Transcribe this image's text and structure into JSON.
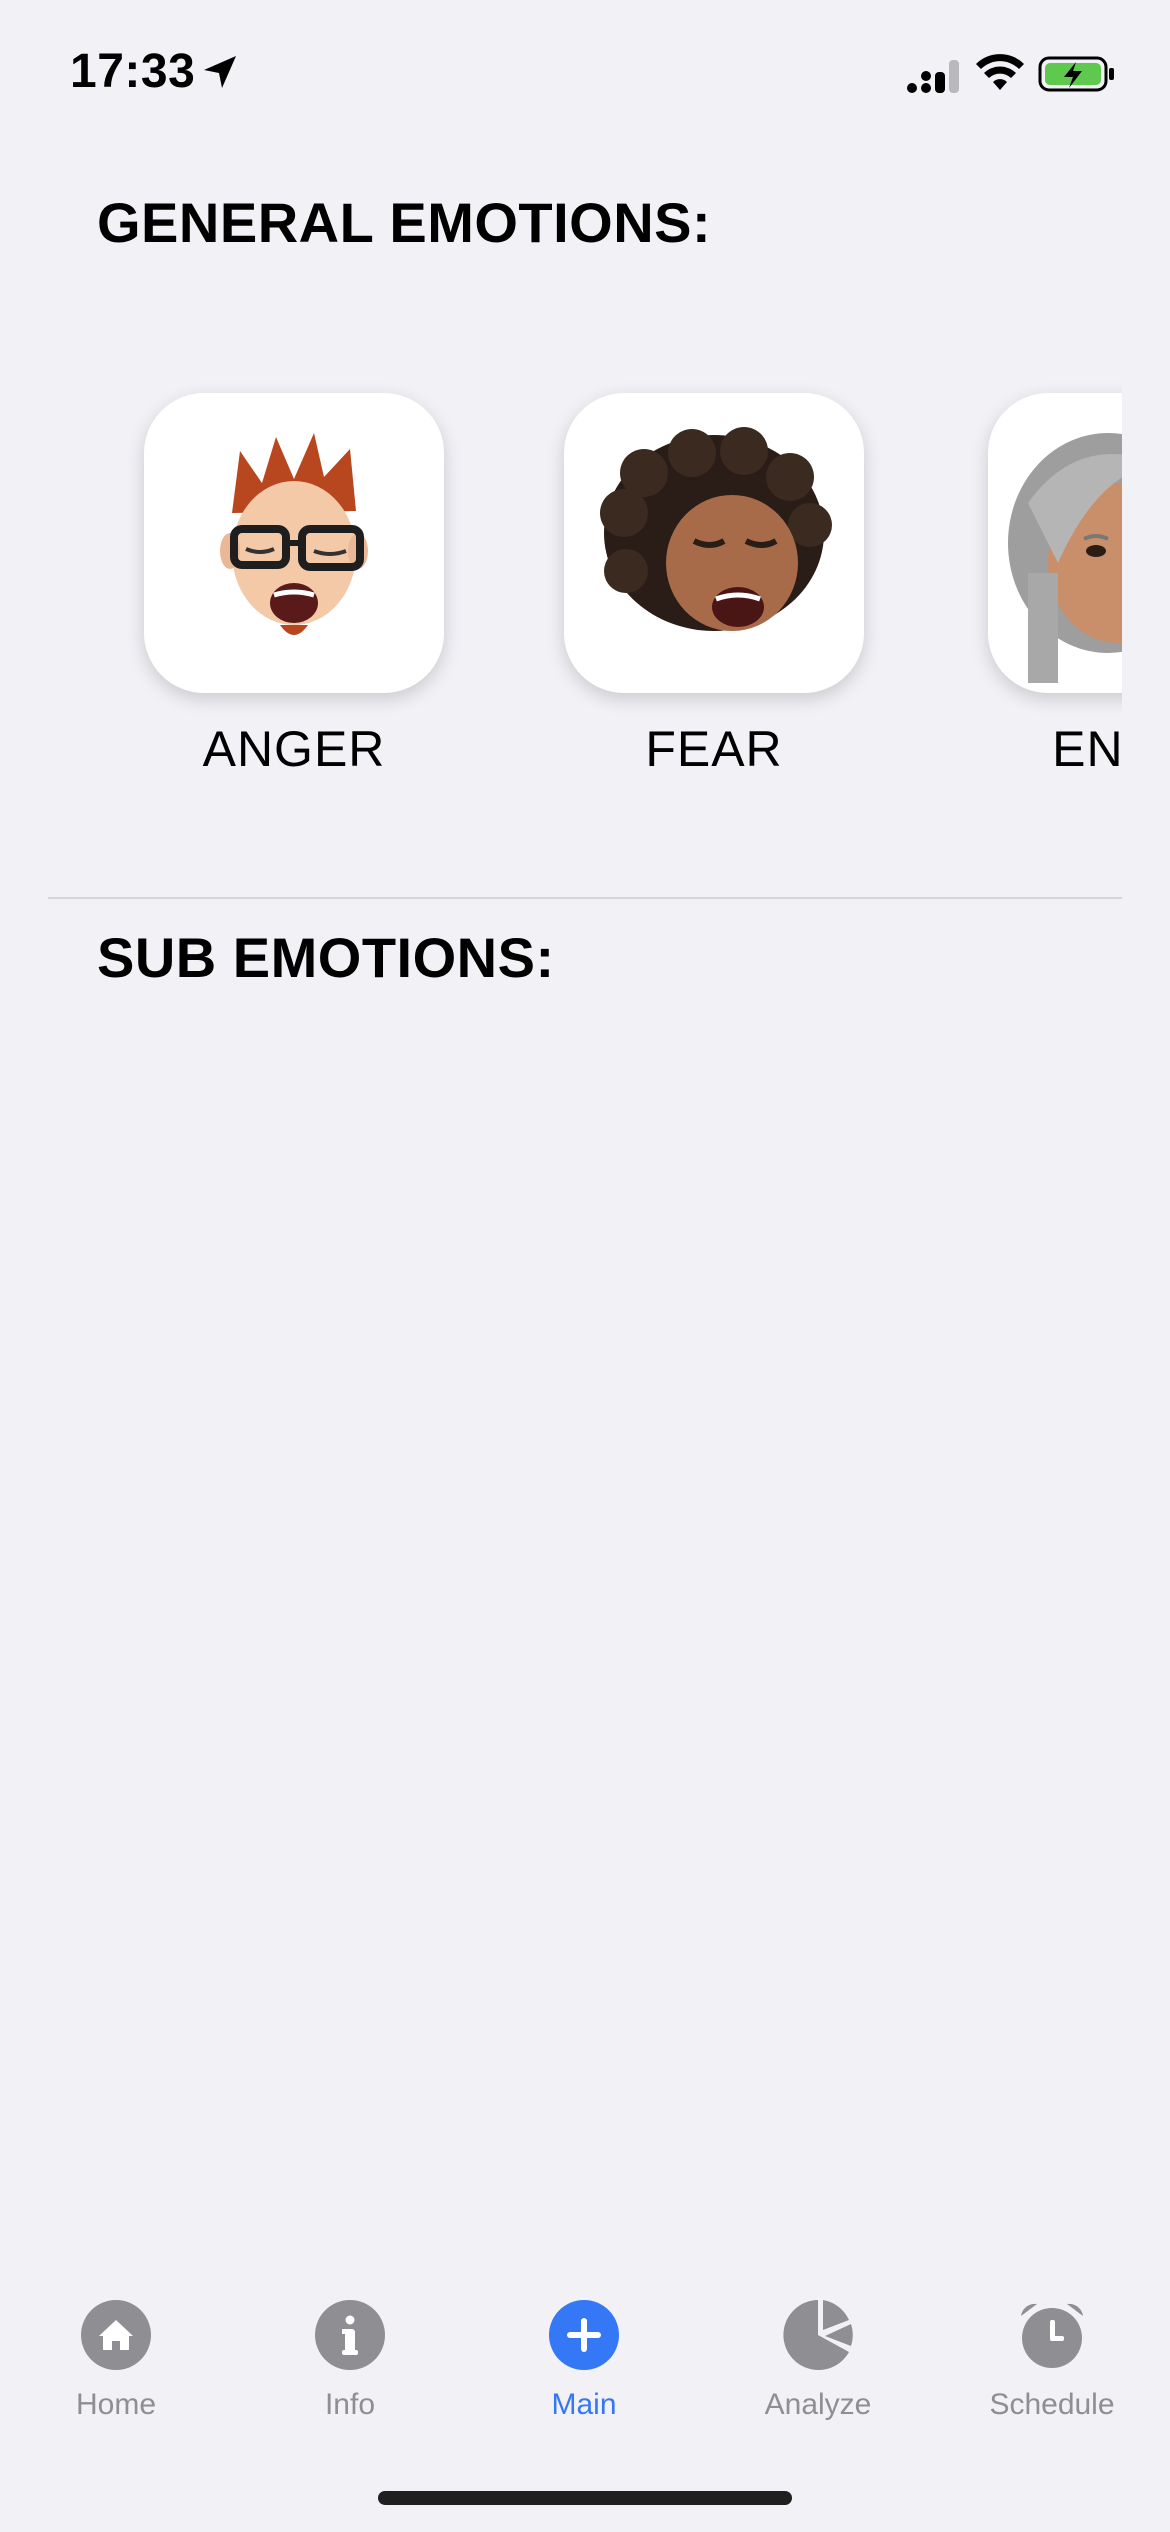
{
  "status_bar": {
    "time": "17:33",
    "icons": [
      "location-arrow-icon",
      "cellular-signal-icon",
      "wifi-icon",
      "battery-charging-icon"
    ]
  },
  "general_section": {
    "title": "GENERAL EMOTIONS:"
  },
  "emotions": [
    {
      "label": "ANGER",
      "icon": "anger-memoji-icon"
    },
    {
      "label": "FEAR",
      "icon": "fear-memoji-icon"
    },
    {
      "label": "ENJOY",
      "icon": "enjoyment-memoji-icon"
    }
  ],
  "sub_section": {
    "title": "SUB EMOTIONS:"
  },
  "tab_bar": {
    "active_color": "#3478f6",
    "inactive_color": "#8e8e93",
    "tabs": [
      {
        "label": "Home",
        "icon": "house-icon",
        "active": false
      },
      {
        "label": "Info",
        "icon": "info-icon",
        "active": false
      },
      {
        "label": "Main",
        "icon": "plus-icon",
        "active": true
      },
      {
        "label": "Analyze",
        "icon": "pie-chart-icon",
        "active": false
      },
      {
        "label": "Schedule",
        "icon": "alarm-clock-icon",
        "active": false
      }
    ]
  }
}
